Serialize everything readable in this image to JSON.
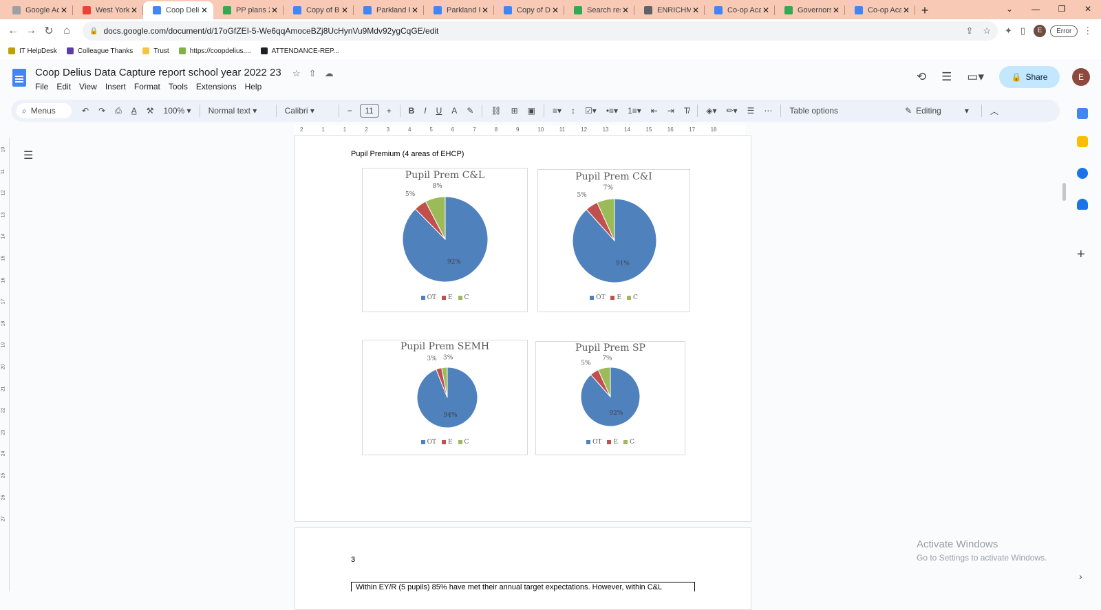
{
  "tabs": [
    {
      "title": "Google Ac",
      "icon": "google-icon",
      "color": "#9aa0a6"
    },
    {
      "title": "West Yorks",
      "icon": "gmail-icon",
      "color": "#ea4335"
    },
    {
      "title": "Coop Deliu",
      "icon": "docs-icon",
      "color": "#4285f4",
      "active": true
    },
    {
      "title": "PP plans 2",
      "icon": "drive-icon",
      "color": "#34a853"
    },
    {
      "title": "Copy of B",
      "icon": "docs-icon",
      "color": "#4285f4"
    },
    {
      "title": "Parkland P",
      "icon": "docs-icon",
      "color": "#4285f4"
    },
    {
      "title": "Parkland P",
      "icon": "docs-icon",
      "color": "#4285f4"
    },
    {
      "title": "Copy of D",
      "icon": "docs-icon",
      "color": "#4285f4"
    },
    {
      "title": "Search res",
      "icon": "drive-icon",
      "color": "#34a853"
    },
    {
      "title": "ENRICHME",
      "icon": "globe-icon",
      "color": "#5f6368"
    },
    {
      "title": "Co-op Aca",
      "icon": "docs-icon",
      "color": "#4285f4"
    },
    {
      "title": "Governors",
      "icon": "drive-icon",
      "color": "#34a853"
    },
    {
      "title": "Co-op Aca",
      "icon": "slides-icon",
      "color": "#4285f4"
    }
  ],
  "url": "docs.google.com/document/d/17oGfZEI-5-We6qqAmoceBZj8UcHynVu9Mdv92ygCqGE/edit",
  "browser": {
    "error_label": "Error",
    "profile_initial": "E"
  },
  "bookmarks": [
    {
      "label": "IT HelpDesk",
      "color": "#c0a000"
    },
    {
      "label": "Colleague Thanks",
      "color": "#5b3ea8"
    },
    {
      "label": "Trust",
      "color": "#f4c542"
    },
    {
      "label": "https://coopdelius....",
      "color": "#7cb342"
    },
    {
      "label": "ATTENDANCE-REP...",
      "color": "#202124"
    }
  ],
  "doc": {
    "title": "Coop Delius Data Capture report school year 2022 23",
    "menus": [
      "File",
      "Edit",
      "View",
      "Insert",
      "Format",
      "Tools",
      "Extensions",
      "Help"
    ],
    "share_label": "Share",
    "user_initial": "E"
  },
  "toolbar": {
    "menus_label": "Menus",
    "zoom": "100%",
    "style": "Normal text",
    "font": "Calibri",
    "font_size": "11",
    "table_options": "Table options",
    "mode": "Editing"
  },
  "ruler_ticks": [
    "2",
    "1",
    "1",
    "2",
    "3",
    "4",
    "5",
    "6",
    "7",
    "8",
    "9",
    "10",
    "11",
    "12",
    "13",
    "14",
    "15",
    "16",
    "17",
    "18"
  ],
  "vruler_ticks": [
    "10",
    "11",
    "12",
    "13",
    "14",
    "15",
    "16",
    "17",
    "18",
    "19",
    "20",
    "21",
    "22",
    "23",
    "24",
    "25",
    "26",
    "27"
  ],
  "page": {
    "caption": "Pupil Premium (4 areas of EHCP)",
    "page_number": "3",
    "text_line": "Within EY/R (5 pupils) 85% have met their annual target expectations. However, within C&L"
  },
  "chart_data": [
    {
      "type": "pie",
      "title": "Pupil Prem C&L",
      "categories": [
        "OT",
        "E",
        "C"
      ],
      "values": [
        92,
        5,
        8
      ],
      "labels": [
        "92%",
        "5%",
        "8%"
      ],
      "colors": [
        "#4f81bd",
        "#c0504d",
        "#9bbb59"
      ],
      "legend": "bottom"
    },
    {
      "type": "pie",
      "title": "Pupil Prem C&I",
      "categories": [
        "OT",
        "E",
        "C"
      ],
      "values": [
        91,
        5,
        7
      ],
      "labels": [
        "91%",
        "5%",
        "7%"
      ],
      "colors": [
        "#4f81bd",
        "#c0504d",
        "#9bbb59"
      ],
      "legend": "bottom"
    },
    {
      "type": "pie",
      "title": "Pupil Prem SEMH",
      "categories": [
        "OT",
        "E",
        "C"
      ],
      "values": [
        94,
        3,
        3
      ],
      "labels": [
        "94%",
        "3%",
        "3%"
      ],
      "colors": [
        "#4f81bd",
        "#c0504d",
        "#9bbb59"
      ],
      "legend": "bottom"
    },
    {
      "type": "pie",
      "title": "Pupil Prem SP",
      "categories": [
        "OT",
        "E",
        "C"
      ],
      "values": [
        92,
        5,
        7
      ],
      "labels": [
        "92%",
        "5%",
        "7%"
      ],
      "colors": [
        "#4f81bd",
        "#c0504d",
        "#9bbb59"
      ],
      "legend": "bottom"
    }
  ],
  "watermark": {
    "line1": "Activate Windows",
    "line2": "Go to Settings to activate Windows."
  }
}
